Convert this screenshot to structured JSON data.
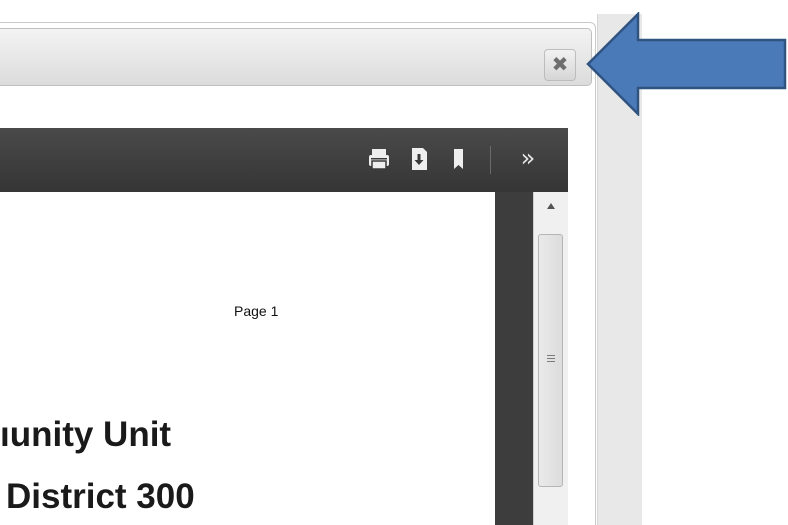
{
  "dialog": {
    "close_label": "✖"
  },
  "viewer": {
    "toolbar": {
      "print_icon": "printer-icon",
      "download_icon": "download-icon",
      "bookmark_icon": "bookmark-icon",
      "more_label": "»"
    },
    "document": {
      "page_label": "Page 1",
      "line1": "ıunity Unit",
      "line2": "District 300"
    }
  },
  "annotation": {
    "arrow_color": "#4a7ab8",
    "arrow_border": "#2f5480"
  }
}
